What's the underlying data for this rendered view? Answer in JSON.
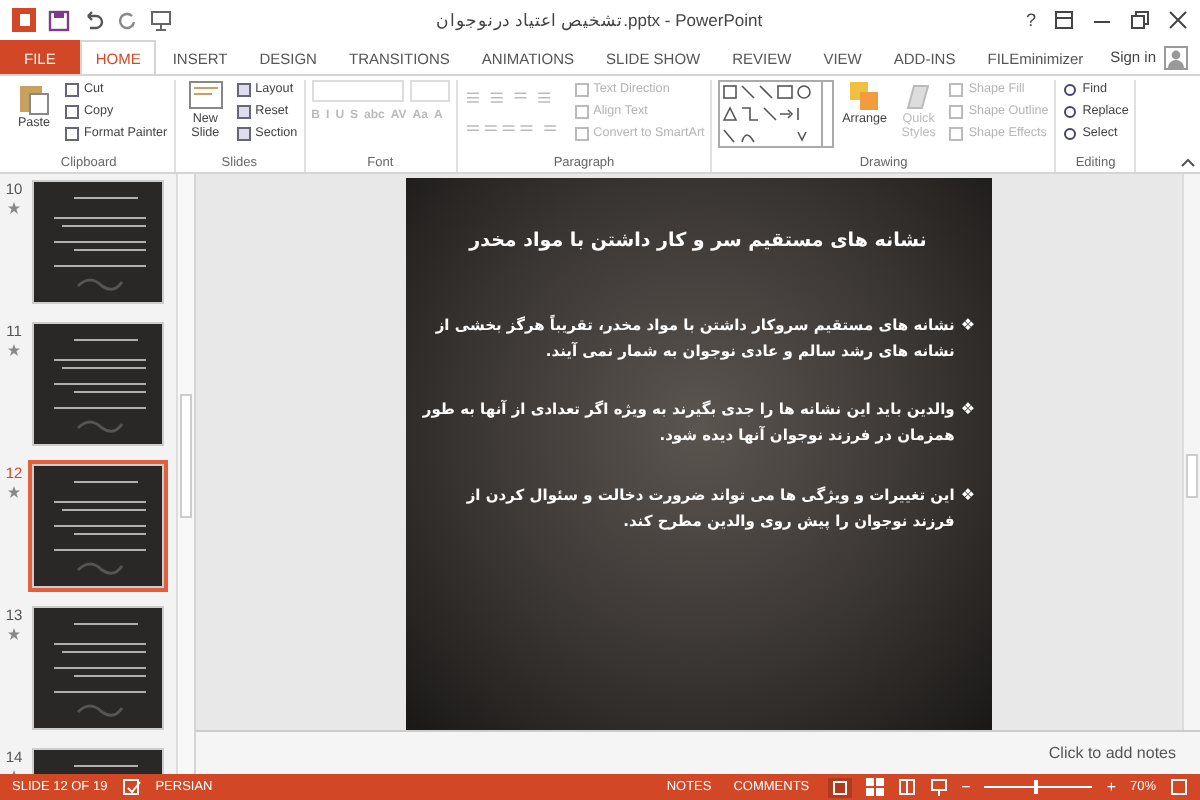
{
  "window": {
    "title": "تشخیص اعتیاد درنوجوان.pptx - PowerPoint",
    "help": "?"
  },
  "account": {
    "label": "Sign in"
  },
  "tabs": [
    {
      "label": "FILE",
      "kind": "file",
      "selected": false
    },
    {
      "label": "HOME",
      "kind": "tab",
      "selected": true
    },
    {
      "label": "INSERT",
      "kind": "tab",
      "selected": false
    },
    {
      "label": "DESIGN",
      "kind": "tab",
      "selected": false
    },
    {
      "label": "TRANSITIONS",
      "kind": "tab",
      "selected": false
    },
    {
      "label": "ANIMATIONS",
      "kind": "tab",
      "selected": false
    },
    {
      "label": "SLIDE SHOW",
      "kind": "tab",
      "selected": false
    },
    {
      "label": "REVIEW",
      "kind": "tab",
      "selected": false
    },
    {
      "label": "VIEW",
      "kind": "tab",
      "selected": false
    },
    {
      "label": "ADD-INS",
      "kind": "tab",
      "selected": false
    },
    {
      "label": "FILEminimizer",
      "kind": "tab",
      "selected": false
    }
  ],
  "ribbon": {
    "clipboard": {
      "label": "Clipboard",
      "paste": "Paste",
      "items": [
        {
          "label": "Cut",
          "disabled": false
        },
        {
          "label": "Copy",
          "disabled": false
        },
        {
          "label": "Format Painter",
          "disabled": false
        }
      ]
    },
    "slides": {
      "label": "Slides",
      "new_slide": "New Slide",
      "items": [
        {
          "label": "Layout",
          "disabled": false
        },
        {
          "label": "Reset",
          "disabled": false
        },
        {
          "label": "Section",
          "disabled": false
        }
      ]
    },
    "font": {
      "label": "Font",
      "buttons": [
        {
          "label": "B",
          "disabled": true
        },
        {
          "label": "I",
          "disabled": true
        },
        {
          "label": "U",
          "disabled": true
        },
        {
          "label": "S",
          "disabled": true
        },
        {
          "label": "abc",
          "disabled": true
        },
        {
          "label": "AV",
          "disabled": true
        },
        {
          "label": "Aa",
          "disabled": true
        },
        {
          "label": "A",
          "disabled": true
        }
      ]
    },
    "paragraph": {
      "label": "Paragraph",
      "items": [
        {
          "label": "Text Direction",
          "disabled": true
        },
        {
          "label": "Align Text",
          "disabled": true
        },
        {
          "label": "Convert to SmartArt",
          "disabled": true
        }
      ]
    },
    "drawing": {
      "label": "Drawing",
      "arrange": "Arrange",
      "quick_styles": {
        "label": "Quick Styles",
        "disabled": true
      },
      "items": [
        {
          "label": "Shape Fill",
          "disabled": true
        },
        {
          "label": "Shape Outline",
          "disabled": true
        },
        {
          "label": "Shape Effects",
          "disabled": true
        }
      ]
    },
    "editing": {
      "label": "Editing",
      "items": [
        {
          "label": "Find",
          "disabled": false
        },
        {
          "label": "Replace",
          "disabled": false
        },
        {
          "label": "Select",
          "disabled": false
        }
      ]
    }
  },
  "thumbnails": [
    {
      "number": "10",
      "selected": false
    },
    {
      "number": "11",
      "selected": false
    },
    {
      "number": "12",
      "selected": true
    },
    {
      "number": "13",
      "selected": false
    },
    {
      "number": "14",
      "selected": false
    }
  ],
  "slide": {
    "title": "نشانه های مستقیم سر و کار داشتن با مواد مخدر",
    "bullets": [
      {
        "marker": "❖",
        "text": "نشانه های مستقیم سروکار داشتن با مواد مخدر، تقریباً هرگز بخشی از نشانه های رشد سالم و عادی نوجوان به شمار نمی آیند."
      },
      {
        "marker": "❖",
        "text": "والدین باید این نشانه ها را جدی بگیرند به ویژه اگر تعدادی از آنها به طور همزمان در فرزند نوجوان آنها دیده شود."
      },
      {
        "marker": "❖",
        "text": "این تغییرات و ویژگی ها می تواند ضرورت دخالت و سئوال کردن از فرزند نوجوان را پیش روی والدین مطرح کند."
      }
    ]
  },
  "notes": {
    "placeholder": "Click to add notes"
  },
  "status_bar": {
    "slide": "SLIDE 12 OF 19",
    "language": "PERSIAN",
    "notes": "NOTES",
    "comments": "COMMENTS",
    "zoom": {
      "level": 0.45,
      "reading": "70%",
      "minus": "−",
      "plus": "+"
    }
  }
}
